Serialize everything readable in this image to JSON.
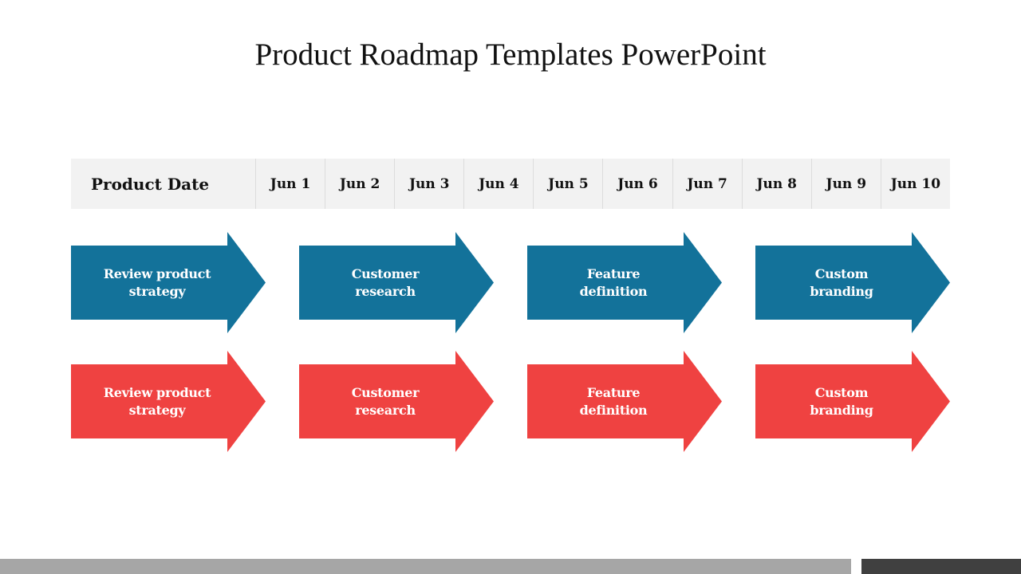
{
  "title": "Product Roadmap Templates PowerPoint",
  "header": {
    "label": "Product Date",
    "dates": [
      "Jun 1",
      "Jun 2",
      "Jun 3",
      "Jun 4",
      "Jun 5",
      "Jun 6",
      "Jun 7",
      "Jun 8",
      "Jun 9",
      "Jun 10"
    ]
  },
  "colors": {
    "blue": "#13729a",
    "red": "#ef4241",
    "header_bg": "#f2f2f2"
  },
  "rows": [
    {
      "color": "blue",
      "items": [
        {
          "line1": "Review product",
          "line2": "strategy"
        },
        {
          "line1": "Customer",
          "line2": "research"
        },
        {
          "line1": "Feature",
          "line2": "definition"
        },
        {
          "line1": "Custom",
          "line2": "branding"
        }
      ]
    },
    {
      "color": "red",
      "items": [
        {
          "line1": "Review product",
          "line2": "strategy"
        },
        {
          "line1": "Customer",
          "line2": "research"
        },
        {
          "line1": "Feature",
          "line2": "definition"
        },
        {
          "line1": "Custom",
          "line2": "branding"
        }
      ]
    }
  ]
}
